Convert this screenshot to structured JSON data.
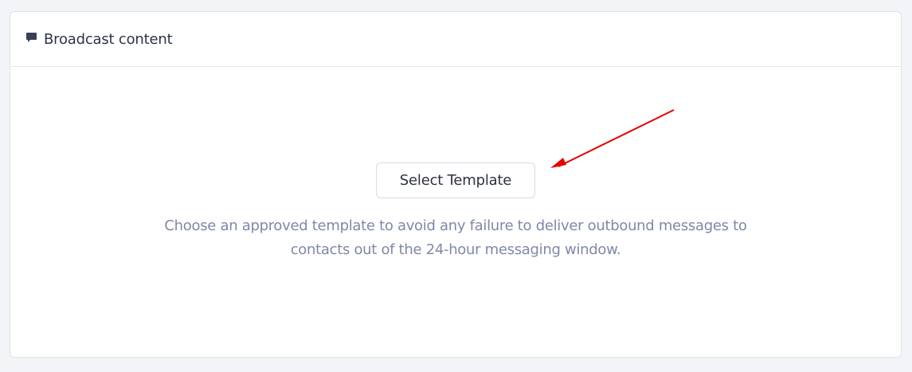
{
  "card": {
    "title": "Broadcast content",
    "icon": "message-icon"
  },
  "main": {
    "button_label": "Select Template",
    "helper_line_1": "Choose an approved template to avoid any failure to deliver outbound messages to",
    "helper_line_2": "contacts out of the 24-hour messaging window."
  },
  "colors": {
    "background": "#f3f4f7",
    "card": "#ffffff",
    "border": "#dfe2e8",
    "title_text": "#2f3447",
    "helper_text": "#7f88a9",
    "annotation_arrow": "#e40000"
  }
}
